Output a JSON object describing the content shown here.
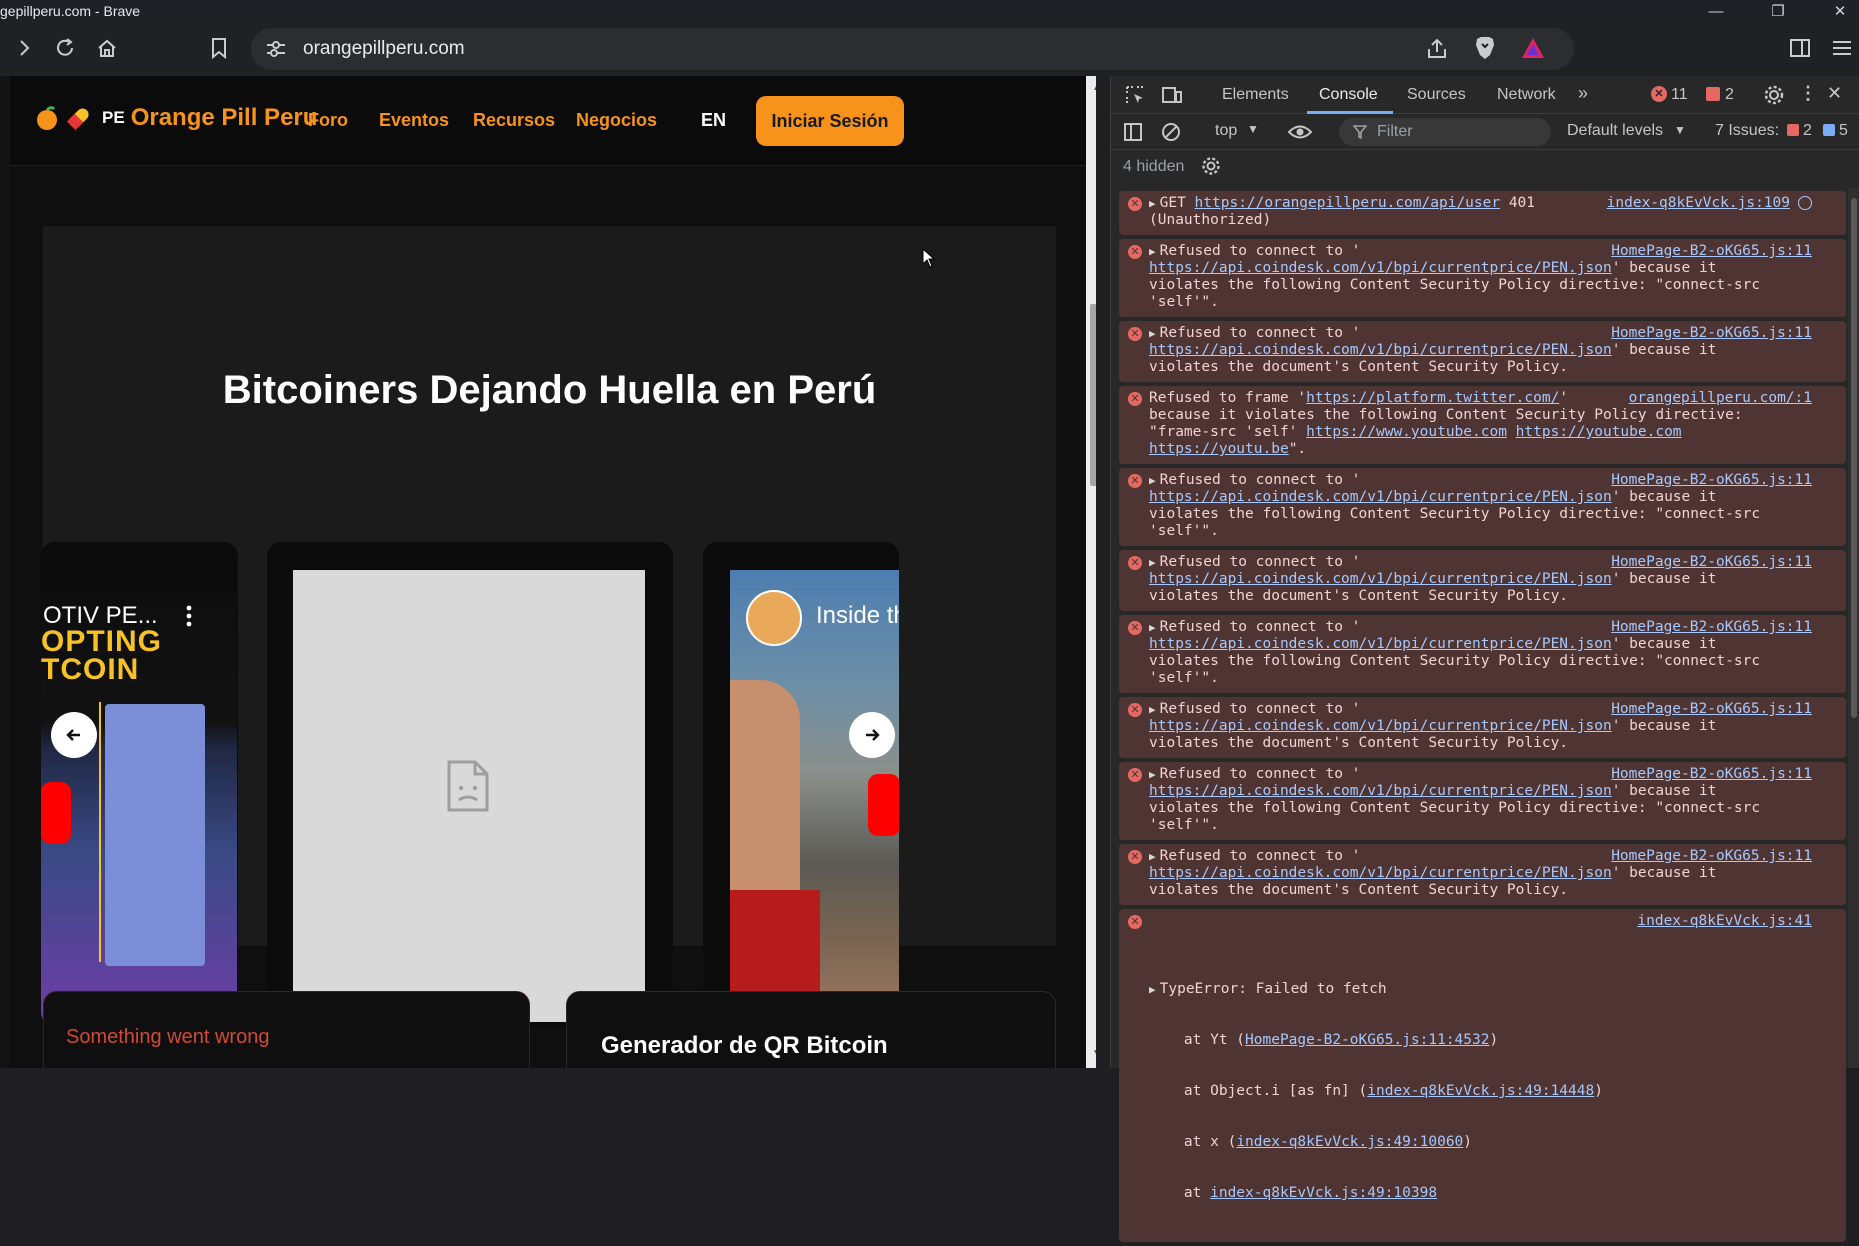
{
  "window": {
    "title": "gepillperu.com - Brave"
  },
  "toolbar": {
    "url": "orangepillperu.com"
  },
  "site": {
    "brand_pe": "PE",
    "brand_name": "Orange Pill Peru",
    "nav": [
      "Foro",
      "Eventos",
      "Recursos",
      "Negocios"
    ],
    "lang": "EN",
    "login": "Iniciar Sesión",
    "hero_title": "Bitcoiners Dejando Huella en Perú",
    "left_video_title": "OTIV PE...",
    "left_video_big1": "OPTING",
    "left_video_big2": "TCOIN",
    "right_video_title": "Inside the",
    "error_text": "Something went wrong",
    "qr_title": "Generador de QR Bitcoin"
  },
  "devtools": {
    "tabs": [
      "Elements",
      "Console",
      "Sources",
      "Network"
    ],
    "active_tab": "Console",
    "error_count": "11",
    "warning_count": "2",
    "context": "top",
    "filter_placeholder": "Filter",
    "levels": "Default levels",
    "issues_label": "7 Issues:",
    "issues_errors": "2",
    "issues_info": "5",
    "hidden": "4 hidden",
    "messages": [
      {
        "source": "index-q8kEvVck.js:109",
        "text_pre": "GET ",
        "link": "https://orangepillperu.com/api/user",
        "text_post": " 401",
        "line2": "(Unauthorized)"
      },
      {
        "source": "HomePage-B2-oKG65.js:11",
        "head": "Refused to connect to '",
        "link": "https://api.coindesk.com/v1/bpi/currentprice/PEN.json",
        "tail": "' because it",
        "line3": "violates the following Content Security Policy directive: \"connect-src",
        "line4": "'self'\"."
      },
      {
        "source": "HomePage-B2-oKG65.js:11",
        "head": "Refused to connect to '",
        "link": "https://api.coindesk.com/v1/bpi/currentprice/PEN.json",
        "tail": "' because it",
        "line3": "violates the document's Content Security Policy."
      },
      {
        "source": "orangepillperu.com/:1",
        "head": "Refused to frame '",
        "link": "https://platform.twitter.com/",
        "tail": "'",
        "line2": "because it violates the following Content Security Policy directive:",
        "line3_pre": "\"frame-src 'self' ",
        "link2": "https://www.youtube.com",
        "link3": "https://youtube.com",
        "link4": "https://youtu.be",
        "line4_post": "\"."
      },
      {
        "source": "HomePage-B2-oKG65.js:11",
        "head": "Refused to connect to '",
        "link": "https://api.coindesk.com/v1/bpi/currentprice/PEN.json",
        "tail": "' because it",
        "line3": "violates the following Content Security Policy directive: \"connect-src",
        "line4": "'self'\"."
      },
      {
        "source": "HomePage-B2-oKG65.js:11",
        "head": "Refused to connect to '",
        "link": "https://api.coindesk.com/v1/bpi/currentprice/PEN.json",
        "tail": "' because it",
        "line3": "violates the document's Content Security Policy."
      },
      {
        "source": "HomePage-B2-oKG65.js:11",
        "head": "Refused to connect to '",
        "link": "https://api.coindesk.com/v1/bpi/currentprice/PEN.json",
        "tail": "' because it",
        "line3": "violates the following Content Security Policy directive: \"connect-src",
        "line4": "'self'\"."
      },
      {
        "source": "HomePage-B2-oKG65.js:11",
        "head": "Refused to connect to '",
        "link": "https://api.coindesk.com/v1/bpi/currentprice/PEN.json",
        "tail": "' because it",
        "line3": "violates the document's Content Security Policy."
      },
      {
        "source": "HomePage-B2-oKG65.js:11",
        "head": "Refused to connect to '",
        "link": "https://api.coindesk.com/v1/bpi/currentprice/PEN.json",
        "tail": "' because it",
        "line3": "violates the following Content Security Policy directive: \"connect-src",
        "line4": "'self'\"."
      },
      {
        "source": "HomePage-B2-oKG65.js:11",
        "head": "Refused to connect to '",
        "link": "https://api.coindesk.com/v1/bpi/currentprice/PEN.json",
        "tail": "' because it",
        "line3": "violates the document's Content Security Policy."
      },
      {
        "source": "index-q8kEvVck.js:41",
        "head": "TypeError: Failed to fetch",
        "st1_pre": "    at Yt (",
        "st1_link": "HomePage-B2-oKG65.js:11:4532",
        "st2_pre": "    at Object.i [as fn] (",
        "st2_link": "index-q8kEvVck.js:49:14448",
        "st3_pre": "    at x (",
        "st3_link": "index-q8kEvVck.js:49:10060",
        "st4_pre": "    at ",
        "st4_link": "index-q8kEvVck.js:49:10398",
        "close_paren": ")"
      }
    ]
  }
}
